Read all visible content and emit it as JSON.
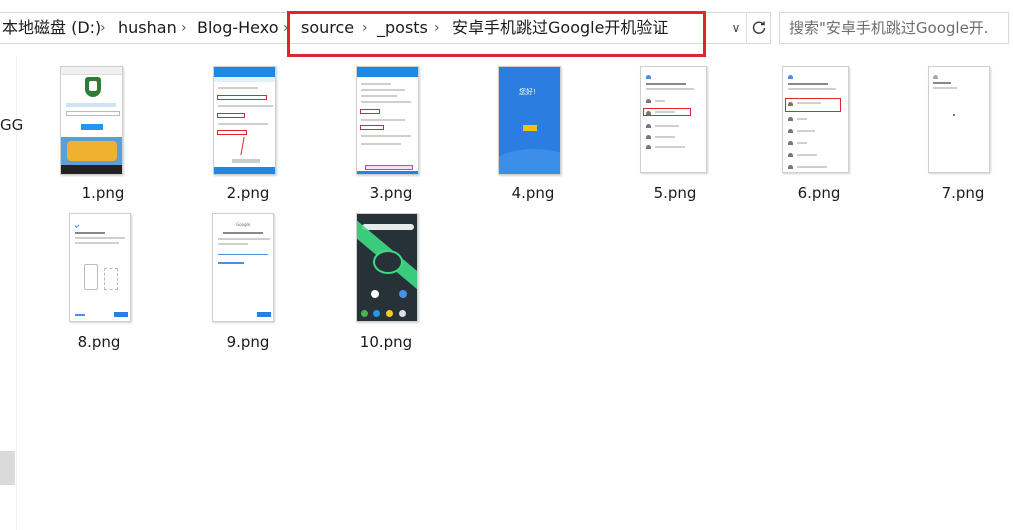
{
  "breadcrumb": {
    "items": [
      "本地磁盘 (D:)",
      "hushan",
      "Blog-Hexo",
      "source",
      "_posts",
      "安卓手机跳过Google开机验证"
    ],
    "separator": "›"
  },
  "search": {
    "placeholder": "搜索\"安卓手机跳过Google开..."
  },
  "nav": {
    "partial_label": "GG"
  },
  "files": [
    {
      "name": "1.png",
      "icon": "image-thumbnail"
    },
    {
      "name": "2.png",
      "icon": "image-thumbnail"
    },
    {
      "name": "3.png",
      "icon": "image-thumbnail"
    },
    {
      "name": "4.png",
      "icon": "image-thumbnail"
    },
    {
      "name": "5.png",
      "icon": "image-thumbnail"
    },
    {
      "name": "6.png",
      "icon": "image-thumbnail"
    },
    {
      "name": "7.png",
      "icon": "image-thumbnail"
    },
    {
      "name": "8.png",
      "icon": "image-thumbnail"
    },
    {
      "name": "9.png",
      "icon": "image-thumbnail"
    },
    {
      "name": "10.png",
      "icon": "image-thumbnail"
    }
  ],
  "thumb_text": {
    "hello": "您好!",
    "google": "Google"
  },
  "colors": {
    "highlight": "#e0262b",
    "android_blue": "#1e88e5",
    "start_yellow": "#f4c20d",
    "launcher_dark": "#263238",
    "launcher_green": "#3ddc84"
  }
}
